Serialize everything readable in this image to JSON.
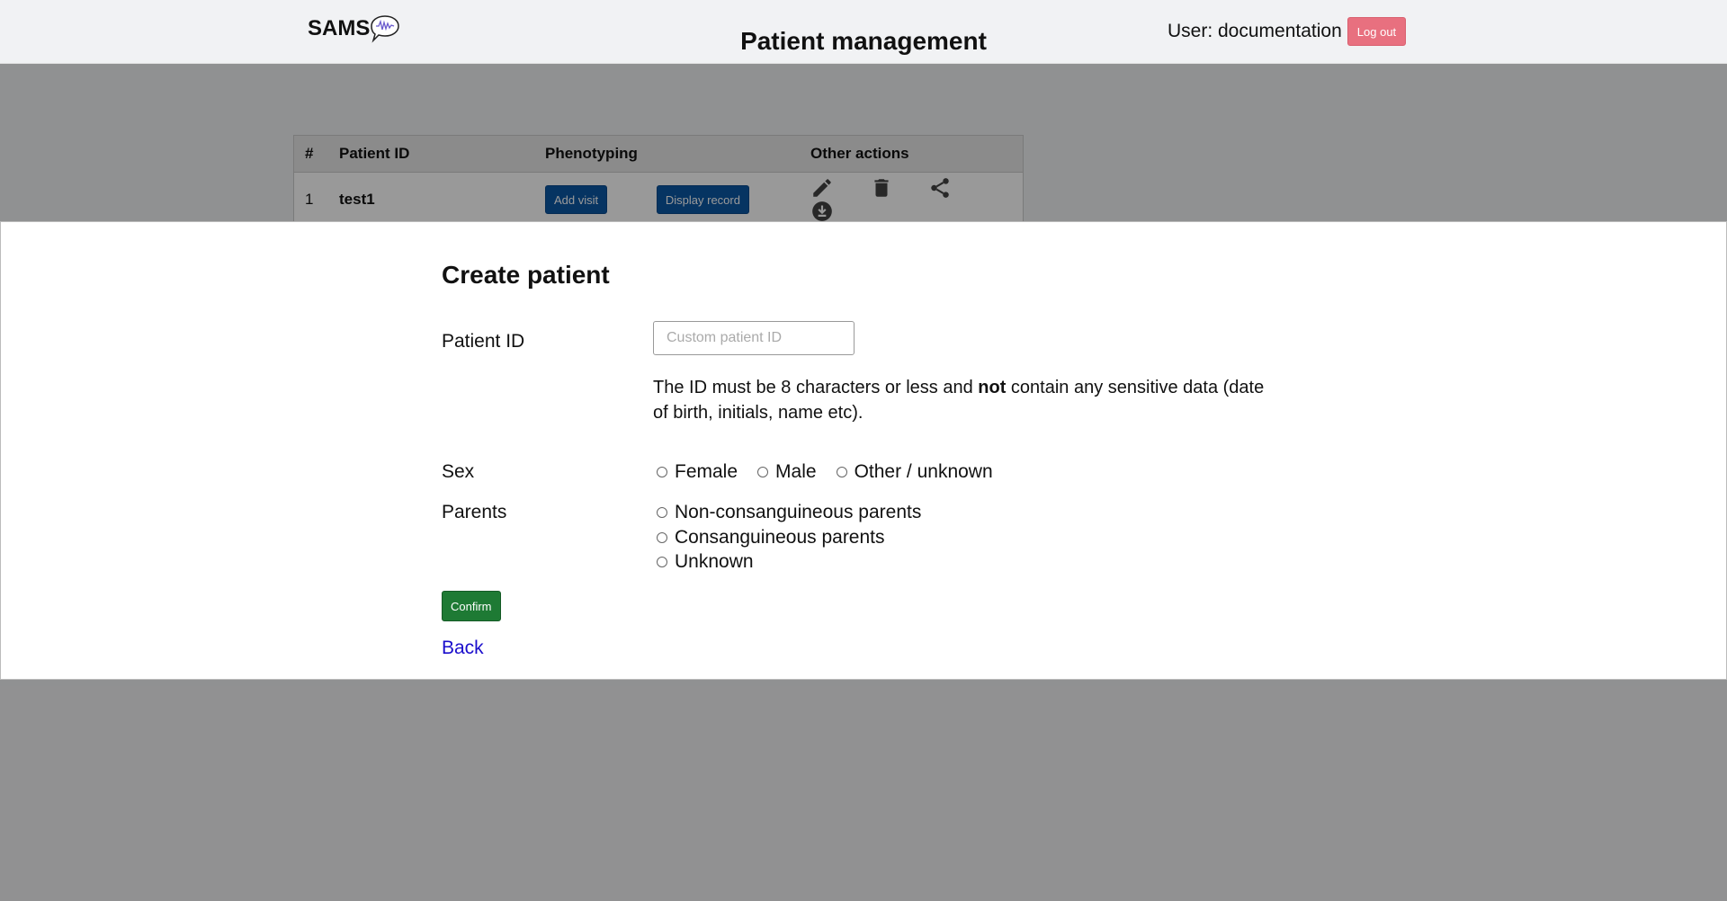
{
  "header": {
    "logo_text": "SAMS",
    "title": "Patient management",
    "user_label": "User: documentation",
    "logout_label": "Log out"
  },
  "table": {
    "columns": [
      "#",
      "Patient ID",
      "Phenotyping",
      "Other actions"
    ],
    "rows": [
      {
        "num": "1",
        "patient_id": "test1",
        "add_visit_label": "Add visit",
        "display_record_label": "Display record",
        "actions": [
          "edit-icon",
          "delete-icon",
          "share-icon",
          "download-icon"
        ]
      }
    ]
  },
  "modal": {
    "title": "Create patient",
    "patient_id_label": "Patient ID",
    "patient_id_placeholder": "Custom patient ID",
    "patient_id_value": "",
    "hint_part1": "The ID must be 8 characters or less and ",
    "hint_bold": "not",
    "hint_part2": " contain any sensitive data (date of birth, initials, name etc).",
    "sex_label": "Sex",
    "sex_options": [
      "Female",
      "Male",
      "Other / unknown"
    ],
    "parents_label": "Parents",
    "parents_options": [
      "Non-consanguineous parents",
      "Consanguineous parents",
      "Unknown"
    ],
    "confirm_label": "Confirm",
    "back_label": "Back"
  },
  "colors": {
    "logout": "#e8707f",
    "primary_blue": "#0b57a4",
    "confirm_green": "#1e7a34",
    "link": "#1a0dcc"
  }
}
